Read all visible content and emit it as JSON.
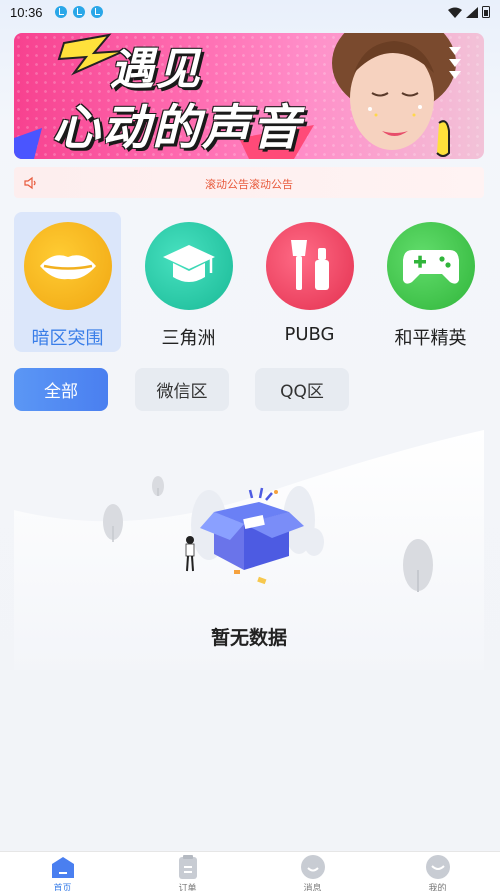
{
  "status_bar": {
    "time": "10:36"
  },
  "banner": {
    "title_line1": "遇见",
    "title_line2": "心动的声音"
  },
  "notice": {
    "text": "滚动公告滚动公告"
  },
  "categories": [
    {
      "label": "暗区突围",
      "color": "#f2b01e",
      "icon": "lips-icon",
      "active": true
    },
    {
      "label": "三角洲",
      "color": "#2fcfae",
      "icon": "graduation-cap-icon",
      "active": false
    },
    {
      "label": "PUBG",
      "color": "#f24a69",
      "icon": "cosmetics-icon",
      "active": false
    },
    {
      "label": "和平精英",
      "color": "#3fc94b",
      "icon": "gamepad-icon",
      "active": false
    }
  ],
  "filter_tabs": [
    {
      "label": "全部",
      "active": true
    },
    {
      "label": "微信区",
      "active": false
    },
    {
      "label": "QQ区",
      "active": false
    }
  ],
  "empty_state": {
    "text": "暂无数据"
  },
  "tabbar": [
    {
      "label": "首页",
      "icon": "home-icon",
      "active": true
    },
    {
      "label": "订单",
      "icon": "order-icon",
      "active": false
    },
    {
      "label": "消息",
      "icon": "message-icon",
      "active": false
    },
    {
      "label": "我的",
      "icon": "profile-icon",
      "active": false
    }
  ],
  "colors": {
    "accent": "#3a7ee8",
    "notice_text": "#e85a3c"
  }
}
